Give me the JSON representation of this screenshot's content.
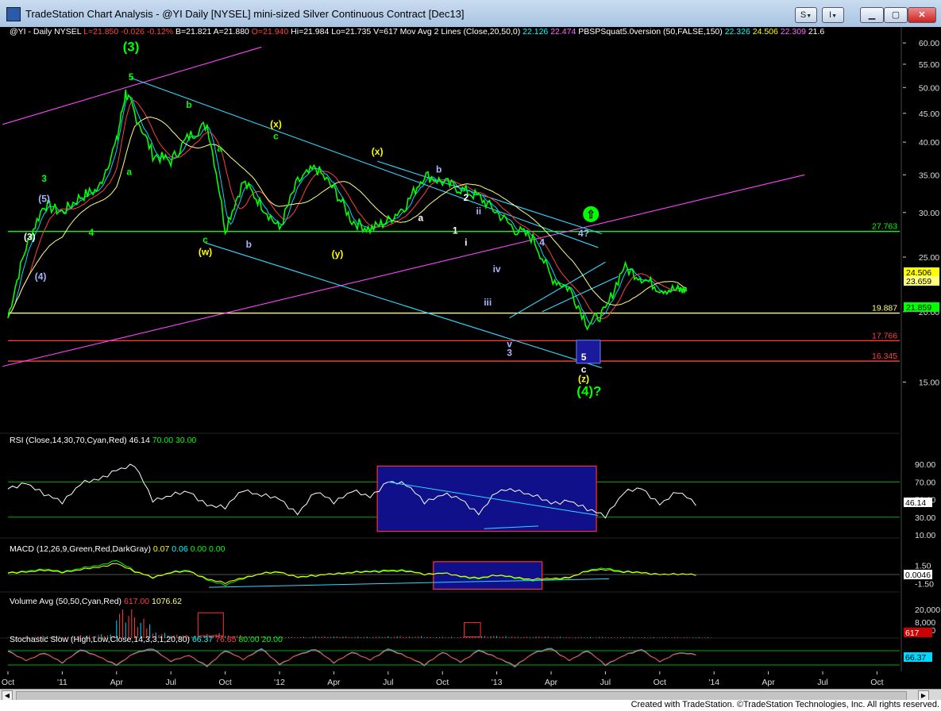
{
  "window": {
    "title": "TradeStation Chart Analysis - @YI Daily [NYSEL] mini-sized Silver Continuous Contract [Dec13]",
    "buttons": {
      "s": "S",
      "i": "I",
      "arrow": "▼"
    }
  },
  "header_items": [
    {
      "text": "@YI - Daily",
      "color": "#ffffff"
    },
    {
      "text": "NYSEL",
      "color": "#ffffff"
    },
    {
      "text": "L=21.850",
      "color": "#ff4040"
    },
    {
      "text": "-0.026",
      "color": "#ff4040"
    },
    {
      "text": "-0.12%",
      "color": "#ff4040"
    },
    {
      "text": "B=21.821",
      "color": "#ffffff"
    },
    {
      "text": "A=21.880",
      "color": "#ffffff"
    },
    {
      "text": "O=21.940",
      "color": "#ff4040"
    },
    {
      "text": "Hi=21.984",
      "color": "#ffffff"
    },
    {
      "text": "Lo=21.735",
      "color": "#ffffff"
    },
    {
      "text": "V=617",
      "color": "#ffffff"
    },
    {
      "text": "Mov Avg 2 Lines (Close,20,50,0)",
      "color": "#ffffff"
    },
    {
      "text": "22.126",
      "color": "#00ffff"
    },
    {
      "text": "22.474",
      "color": "#ff66ff"
    },
    {
      "text": "PBSPSquat5.0version (50,FALSE,150)",
      "color": "#ffffff"
    },
    {
      "text": "22.326",
      "color": "#00ffff"
    },
    {
      "text": "24.506",
      "color": "#ffff00"
    },
    {
      "text": "22.309",
      "color": "#ff66ff"
    },
    {
      "text": "21.6",
      "color": "#ffffff"
    }
  ],
  "chart_data": [
    {
      "type": "line",
      "name": "price",
      "y_axis_ticks": [
        15,
        20,
        25,
        30,
        35,
        40,
        45,
        50,
        55,
        60
      ],
      "y_axis_labels": [
        "15.00",
        "20.00",
        "25.00",
        "30.00",
        "35.00",
        "40.00",
        "45.00",
        "50.00",
        "55.00",
        "60.00"
      ],
      "log_scale": true,
      "x_axis_labels": [
        "Oct",
        "'11",
        "Apr",
        "Jul",
        "Oct",
        "'12",
        "Apr",
        "Jul",
        "Oct",
        "'13",
        "Apr",
        "Jul",
        "Oct",
        "'14",
        "Apr",
        "Jul",
        "Oct"
      ],
      "close_path_months": [
        0,
        1,
        2,
        3,
        4,
        5,
        6,
        6.5,
        7,
        8,
        9,
        10,
        11,
        12,
        13,
        14,
        15,
        16,
        17,
        18,
        19,
        20,
        21,
        22,
        23,
        24,
        25,
        26,
        27,
        28,
        29,
        30,
        31,
        32,
        33,
        34,
        35,
        36,
        37,
        37.5
      ],
      "close_path_values": [
        19.5,
        26,
        31,
        30,
        32,
        33,
        40,
        49,
        45,
        38,
        37,
        41,
        43,
        28,
        34,
        31,
        28,
        34,
        36,
        33,
        29,
        28,
        29,
        31,
        35,
        34,
        33,
        32,
        30,
        28,
        27,
        23,
        22,
        19,
        20,
        24,
        23,
        22,
        21.85,
        21.85
      ],
      "horizontal_lines": [
        {
          "value": 27.763,
          "label": "27.763",
          "color": "#00ff00"
        },
        {
          "value": 19.887,
          "label": "19.887",
          "color": "#ffff80"
        },
        {
          "value": 17.766,
          "label": "17.766",
          "color": "#ff4040"
        },
        {
          "value": 16.345,
          "label": "16.345",
          "color": "#ff4040"
        }
      ],
      "right_tags": [
        {
          "label": "24.506",
          "color": "#ffff00"
        },
        {
          "label": "23.659",
          "color": "#ffff80"
        },
        {
          "label": "21.859",
          "color": "#00ff00"
        }
      ],
      "wave_labels": [
        {
          "text": "(3)",
          "color": "#00ff00",
          "m": 6.8,
          "v": 58
        },
        {
          "text": "5",
          "color": "#00ff00",
          "m": 6.8,
          "v": 51.5
        },
        {
          "text": "3",
          "color": "#00ff00",
          "m": 2.0,
          "v": 34
        },
        {
          "text": "(5)",
          "color": "#aab4ff",
          "m": 2.0,
          "v": 31.3
        },
        {
          "text": "(3)",
          "color": "#ffffff",
          "m": 1.2,
          "v": 26.8
        },
        {
          "text": "(4)",
          "color": "#aab4ff",
          "m": 1.8,
          "v": 22.8
        },
        {
          "text": "4",
          "color": "#00ff00",
          "m": 4.6,
          "v": 27.3
        },
        {
          "text": "a",
          "color": "#00ff00",
          "m": 6.7,
          "v": 35
        },
        {
          "text": "b",
          "color": "#00ff00",
          "m": 10,
          "v": 46
        },
        {
          "text": "c",
          "color": "#00ff00",
          "m": 10.9,
          "v": 26.5
        },
        {
          "text": "(w)",
          "color": "#ffff00",
          "m": 10.9,
          "v": 25.2
        },
        {
          "text": "a",
          "color": "#00ff00",
          "m": 11.7,
          "v": 38.5
        },
        {
          "text": "b",
          "color": "#aab4ff",
          "m": 13.3,
          "v": 26
        },
        {
          "text": "c",
          "color": "#00ff00",
          "m": 14.8,
          "v": 40.5
        },
        {
          "text": "(x)",
          "color": "#ffff00",
          "m": 14.8,
          "v": 42.5
        },
        {
          "text": "(y)",
          "color": "#ffff00",
          "m": 18.2,
          "v": 25
        },
        {
          "text": "(x)",
          "color": "#ffff00",
          "m": 20.4,
          "v": 38
        },
        {
          "text": "a",
          "color": "#ffffff",
          "m": 22.8,
          "v": 29
        },
        {
          "text": "b",
          "color": "#aab4ff",
          "m": 23.8,
          "v": 35.3
        },
        {
          "text": "1",
          "color": "#ffffff",
          "m": 24.7,
          "v": 27.5
        },
        {
          "text": "2",
          "color": "#ffffff",
          "m": 25.3,
          "v": 31.5
        },
        {
          "text": "i",
          "color": "#ffffff",
          "m": 25.3,
          "v": 26.2
        },
        {
          "text": "ii",
          "color": "#aab4ff",
          "m": 26,
          "v": 29.8
        },
        {
          "text": "iii",
          "color": "#aab4ff",
          "m": 26.5,
          "v": 20.5
        },
        {
          "text": "iv",
          "color": "#aab4ff",
          "m": 27,
          "v": 23.5
        },
        {
          "text": "v",
          "color": "#aab4ff",
          "m": 27.7,
          "v": 17.3
        },
        {
          "text": "3",
          "color": "#aab4ff",
          "m": 27.7,
          "v": 16.7
        },
        {
          "text": "4",
          "color": "#aab4ff",
          "m": 29.5,
          "v": 26.2
        },
        {
          "text": "4?",
          "color": "#aab4ff",
          "m": 31.8,
          "v": 27.2
        },
        {
          "text": "5",
          "color": "#ffffff",
          "m": 31.8,
          "v": 16.4
        },
        {
          "text": "c",
          "color": "#ffffff",
          "m": 31.8,
          "v": 15.6
        },
        {
          "text": "(z)",
          "color": "#ffff00",
          "m": 31.8,
          "v": 15.0
        },
        {
          "text": "(4)?",
          "color": "#00ff00",
          "m": 32.1,
          "v": 14.2
        }
      ]
    },
    {
      "type": "line",
      "name": "RSI",
      "header": "RSI (Close,14,30,70,Cyan,Red)",
      "header_values": [
        {
          "text": "46.14",
          "color": "#ffffff"
        },
        {
          "text": "70.00",
          "color": "#00ff00"
        },
        {
          "text": "30.00",
          "color": "#00ff00"
        }
      ],
      "y_axis_labels": [
        "10.00",
        "30.00",
        "50.00",
        "70.00",
        "90.00"
      ],
      "y_axis_ticks": [
        10,
        30,
        50,
        70,
        90
      ],
      "levels": [
        70,
        30
      ],
      "last_value_tag": "46.14",
      "values": [
        62,
        70,
        55,
        48,
        68,
        72,
        85,
        88,
        50,
        55,
        58,
        45,
        40,
        62,
        55,
        50,
        35,
        58,
        48,
        60,
        52,
        72,
        66,
        48,
        56,
        50,
        35,
        58,
        62,
        55,
        45,
        50,
        38,
        32,
        58,
        62,
        46,
        58,
        46
      ]
    },
    {
      "type": "line",
      "name": "MACD",
      "header": "MACD (12,26,9,Green,Red,DarkGray)",
      "header_values": [
        {
          "text": "0.07",
          "color": "#ffff00"
        },
        {
          "text": "0.06",
          "color": "#00ffff"
        },
        {
          "text": "0.00",
          "color": "#00ff00"
        },
        {
          "text": "0.00",
          "color": "#00ff00"
        }
      ],
      "y_axis_labels": [
        "1.50",
        "0.0046",
        "-1.50"
      ],
      "y_axis_ticks": [
        1.5,
        0,
        -1.5
      ],
      "last_value_tag": "0.0046",
      "values": [
        0.3,
        0.6,
        0.8,
        0.5,
        1.0,
        1.4,
        2.4,
        0.5,
        -0.5,
        0.4,
        0.6,
        -0.8,
        -1.8,
        -0.6,
        0.2,
        0.4,
        -0.4,
        -0.3,
        0.2,
        0.4,
        0.5,
        0.8,
        0.6,
        0.1,
        0.3,
        -0.4,
        -0.6,
        -0.2,
        -0.5,
        -1.0,
        -0.9,
        -0.5,
        0.6,
        1.1,
        0.5,
        0.3,
        0.1,
        0.0,
        0.0046
      ]
    },
    {
      "type": "bar",
      "name": "Volume",
      "header": "Volume Avg (50,50,Cyan,Red)",
      "header_values": [
        {
          "text": "617.00",
          "color": "#ff4040"
        },
        {
          "text": "1076.62",
          "color": "#ffff80"
        }
      ],
      "y_axis_labels": [
        "2,000",
        "8,000",
        "20,000"
      ],
      "y_axis_ticks": [
        2000,
        8000,
        20000
      ],
      "last_value_tag": "617",
      "values": [
        800,
        1200,
        1500,
        1400,
        2200,
        3000,
        24000,
        15000,
        4000,
        2500,
        2000,
        3500,
        2200,
        1500,
        1200,
        1000,
        900,
        1300,
        1200,
        1000,
        1100,
        1400,
        1300,
        1000,
        900,
        1100,
        1800,
        1500,
        1000,
        1200,
        900,
        800,
        900,
        700,
        800,
        700,
        700,
        600,
        617
      ]
    },
    {
      "type": "line",
      "name": "Stochastic",
      "header": "Stochastic Slow (High,Low,Close,14,3,3,1,20,80)",
      "header_values": [
        {
          "text": "66.37",
          "color": "#00ffff"
        },
        {
          "text": "76.65",
          "color": "#ff4040"
        },
        {
          "text": "80.00",
          "color": "#00ff00"
        },
        {
          "text": "20.00",
          "color": "#00ff00"
        }
      ],
      "y_axis_labels": [
        "66.37"
      ],
      "last_value_tag": "66.37",
      "levels": [
        80,
        20
      ],
      "values": [
        80,
        40,
        70,
        30,
        85,
        55,
        20,
        70,
        90,
        35,
        60,
        15,
        80,
        45,
        90,
        20,
        65,
        85,
        30,
        75,
        40,
        90,
        55,
        20,
        75,
        30,
        85,
        50,
        15,
        70,
        90,
        40,
        80,
        20,
        60,
        85,
        35,
        70,
        66
      ]
    }
  ],
  "footer": {
    "text": "Created with TradeStation. ©TradeStation Technologies, Inc. All rights reserved."
  }
}
